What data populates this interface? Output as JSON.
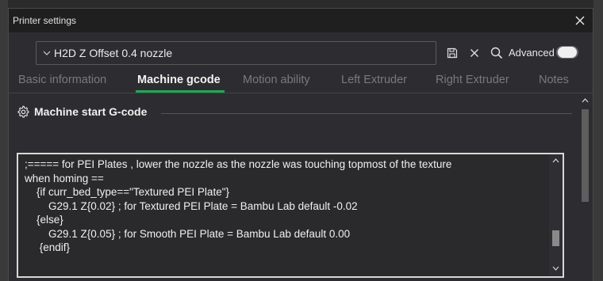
{
  "window": {
    "title": "Printer settings"
  },
  "preset": {
    "value": "H2D Z Offset 0.4 nozzle"
  },
  "toolbar": {
    "advanced_label": "Advanced",
    "advanced_enabled": false
  },
  "tabs": [
    {
      "label": "Basic information",
      "active": false
    },
    {
      "label": "Machine gcode",
      "active": true
    },
    {
      "label": "Motion ability",
      "active": false
    },
    {
      "label": "Left Extruder",
      "active": false
    },
    {
      "label": "Right Extruder",
      "active": false
    },
    {
      "label": "Notes",
      "active": false
    }
  ],
  "section": {
    "title": "Machine start G-code",
    "code": ";===== for PEI Plates , lower the nozzle as the nozzle was touching topmost of the texture\nwhen homing ==\n    {if curr_bed_type==\"Textured PEI Plate\"}\n        G29.1 Z{0.02} ; for Textured PEI Plate = Bambu Lab default -0.02\n    {else}\n        G29.1 Z{0.05} ; for Smooth PEI Plate = Bambu Lab default 0.00\n     {endif}"
  },
  "colors": {
    "accent": "#1fa855",
    "background": "#2d2d31",
    "titlebar": "#1f1f1f"
  }
}
